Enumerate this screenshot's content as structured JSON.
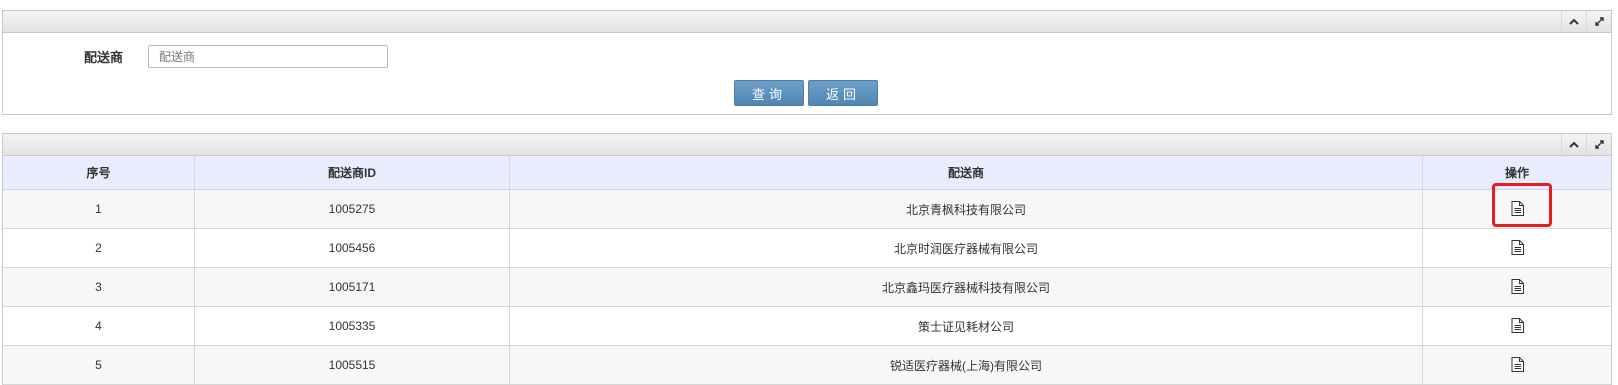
{
  "search": {
    "label": "配送商",
    "placeholder": "配送商",
    "value": "",
    "query_button": "查询",
    "back_button": "返回"
  },
  "table": {
    "headers": [
      "序号",
      "配送商ID",
      "配送商",
      "操作"
    ],
    "rows": [
      {
        "seq": "1",
        "id": "1005275",
        "name": "北京青枫科技有限公司"
      },
      {
        "seq": "2",
        "id": "1005456",
        "name": "北京时润医疗器械有限公司"
      },
      {
        "seq": "3",
        "id": "1005171",
        "name": "北京鑫玛医疗器械科技有限公司"
      },
      {
        "seq": "4",
        "id": "1005335",
        "name": "策士证见耗材公司"
      },
      {
        "seq": "5",
        "id": "1005515",
        "name": "锐适医疗器械(上海)有限公司"
      }
    ],
    "action_icon": "document-icon"
  },
  "panel_tools": [
    "collapse-icon",
    "expand-icon"
  ],
  "colors": {
    "header_bg": "#e9ecff",
    "button_bg": "#5b8fbb",
    "highlight": "#e11f1f"
  }
}
